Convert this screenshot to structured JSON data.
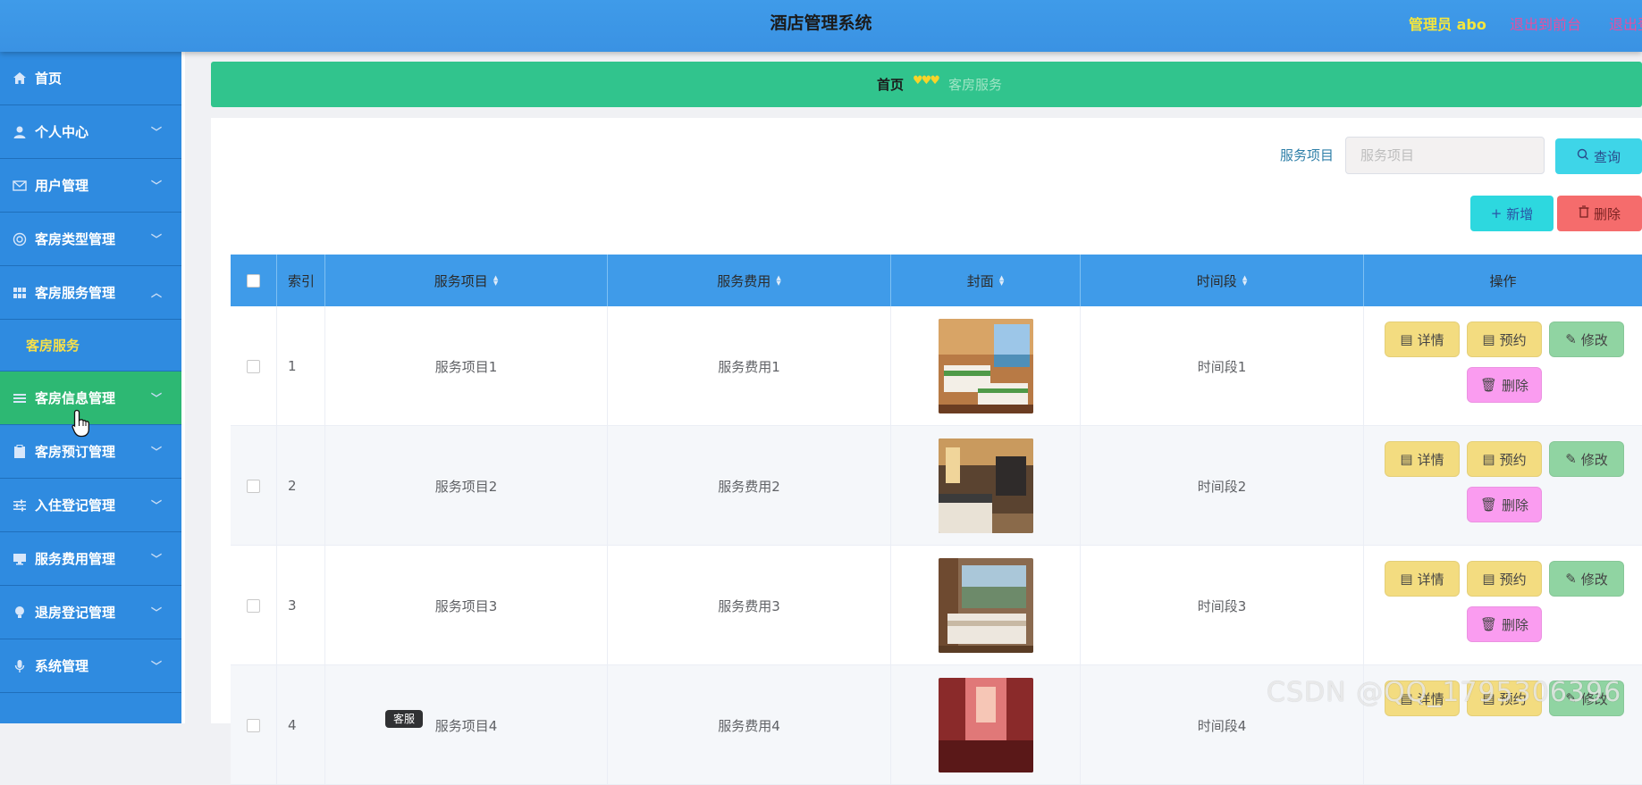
{
  "header": {
    "title": "酒店管理系统",
    "user": "管理员 abo",
    "link_front": "退出到前台",
    "link_logout": "退出登录"
  },
  "sidebar": {
    "items": [
      {
        "label": "首页",
        "icon": "home-icon"
      },
      {
        "label": "个人中心",
        "icon": "user-icon"
      },
      {
        "label": "用户管理",
        "icon": "mail-icon"
      },
      {
        "label": "客房类型管理",
        "icon": "globe-icon"
      },
      {
        "label": "客房服务管理",
        "icon": "grid-icon",
        "expanded": true
      },
      {
        "label": "客房信息管理",
        "icon": "list-icon",
        "active": true
      },
      {
        "label": "客房预订管理",
        "icon": "clipboard-icon"
      },
      {
        "label": "入住登记管理",
        "icon": "sliders-icon"
      },
      {
        "label": "服务费用管理",
        "icon": "monitor-icon"
      },
      {
        "label": "退房登记管理",
        "icon": "bulb-icon"
      },
      {
        "label": "系统管理",
        "icon": "mic-icon"
      }
    ],
    "submenu_label": "客房服务"
  },
  "breadcrumb": {
    "home": "首页",
    "separator": "♥♥♥",
    "current": "客房服务"
  },
  "search": {
    "label": "服务项目",
    "placeholder": "服务项目",
    "query_button": "查询"
  },
  "toolbar": {
    "add_label": "新增",
    "delete_label": "删除"
  },
  "table": {
    "columns": [
      "索引",
      "服务项目",
      "服务费用",
      "封面",
      "时间段",
      "操作"
    ],
    "rows": [
      {
        "index": "1",
        "item": "服务项目1",
        "fee": "服务费用1",
        "period": "时间段1"
      },
      {
        "index": "2",
        "item": "服务项目2",
        "fee": "服务费用2",
        "period": "时间段2"
      },
      {
        "index": "3",
        "item": "服务项目3",
        "fee": "服务费用3",
        "period": "时间段3"
      },
      {
        "index": "4",
        "item": "服务项目4",
        "fee": "服务费用4",
        "period": "时间段4"
      }
    ],
    "actions": {
      "detail": "详情",
      "reserve": "预约",
      "edit": "修改",
      "delete": "删除"
    }
  },
  "tooltip": "客服",
  "watermark": "CSDN @QQ_1795306396",
  "colors": {
    "header": "#3f9be9",
    "sidebar": "#2f8be0",
    "active_menu": "#2db873",
    "breadcrumb": "#31c48d",
    "detail_btn": "#f3dc80",
    "edit_btn": "#90d4a2",
    "delete_btn": "#fa9cf0"
  }
}
